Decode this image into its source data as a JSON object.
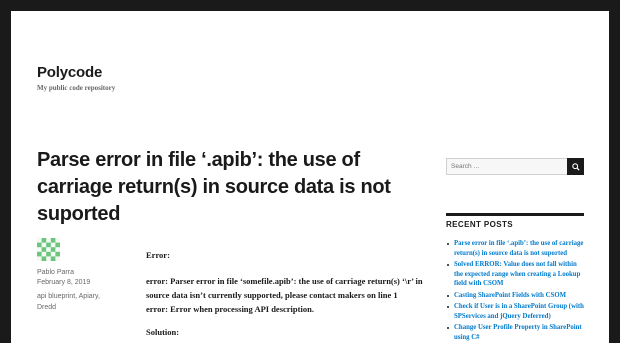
{
  "site": {
    "title": "Polycode",
    "description": "My public code repository"
  },
  "post": {
    "title": "Parse error in file ‘.apib’: the use of carriage return(s) in source data is not suported",
    "author": "Pablo Parra",
    "date": "February 8, 2019",
    "tags": "api blueprint, Apiary, Dredd",
    "content": {
      "error_heading": "Error:",
      "error_line1": "error: Parser error in file ‘somefile.apib’: the use of carriage return(s) ‘\\r’ in source data isn’t currently supported, please contact makers on line 1",
      "error_line2": "error: Error when processing API description.",
      "solution_heading": "Solution:"
    }
  },
  "sidebar": {
    "search_placeholder": "Search …",
    "search_icon": "search-icon",
    "recent_posts_title": "RECENT POSTS",
    "recent_posts": [
      "Parse error in file ‘.apib’: the use of carriage return(s) in source data is not suported",
      "Solved ERROR: Value does not fall within the expected range when creating a Lookup field with CSOM",
      "Casting SharePoint Fields with CSOM",
      "Check if User is in a SharePoint Group (with SPServices and jQuery Deferred)",
      "Change User Profile Property in SharePoint using C#"
    ]
  },
  "colors": {
    "frame": "#1a1a1a",
    "link": "#007acc",
    "muted": "#686868"
  }
}
